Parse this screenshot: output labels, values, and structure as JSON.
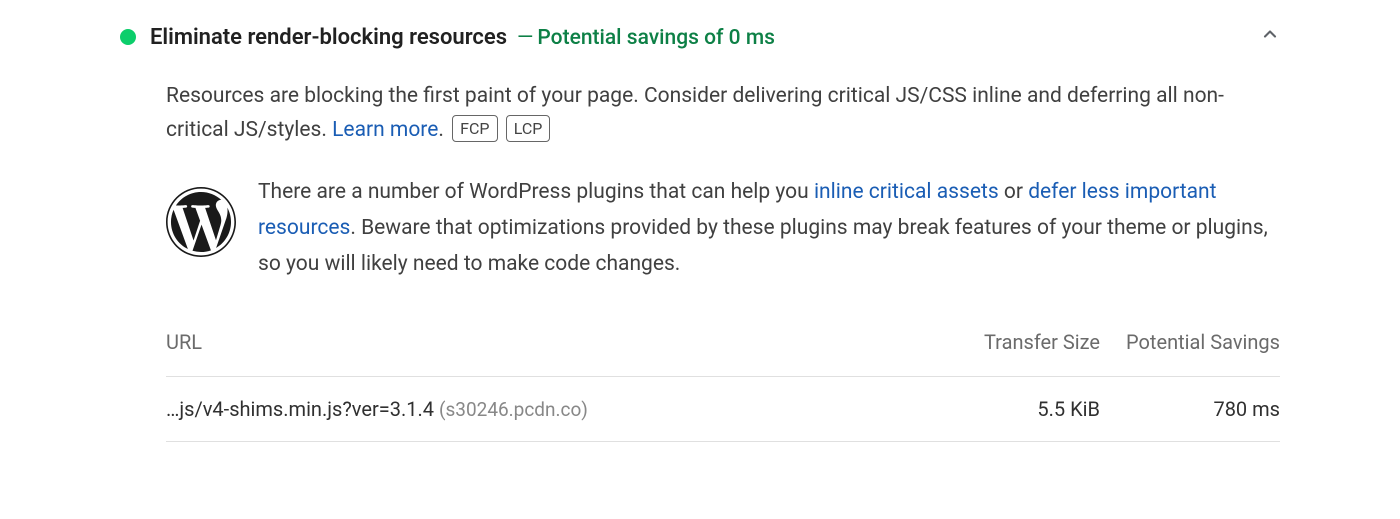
{
  "audit": {
    "title": "Eliminate render-blocking resources",
    "savings_sep": "—",
    "savings_label": "Potential savings of 0 ms",
    "description_part1": "Resources are blocking the first paint of your page. Consider delivering critical JS/CSS inline and deferring all non-critical JS/styles. ",
    "learn_more": "Learn more",
    "description_period": ".",
    "metric_tags": {
      "fcp": "FCP",
      "lcp": "LCP"
    },
    "wp_tip": {
      "part1": "There are a number of WordPress plugins that can help you ",
      "link1": "inline critical assets",
      "part2": " or ",
      "link2": "defer less important resources",
      "part3": ". Beware that optimizations provided by these plugins may break features of your theme or plugins, so you will likely need to make code changes."
    },
    "table": {
      "headers": {
        "url": "URL",
        "size": "Transfer Size",
        "savings": "Potential Savings"
      },
      "rows": [
        {
          "url_path": "…js/v4-shims.min.js?ver=3.1.4",
          "url_domain": "(s30246.pcdn.co)",
          "size": "5.5 KiB",
          "savings": "780 ms"
        }
      ]
    }
  }
}
